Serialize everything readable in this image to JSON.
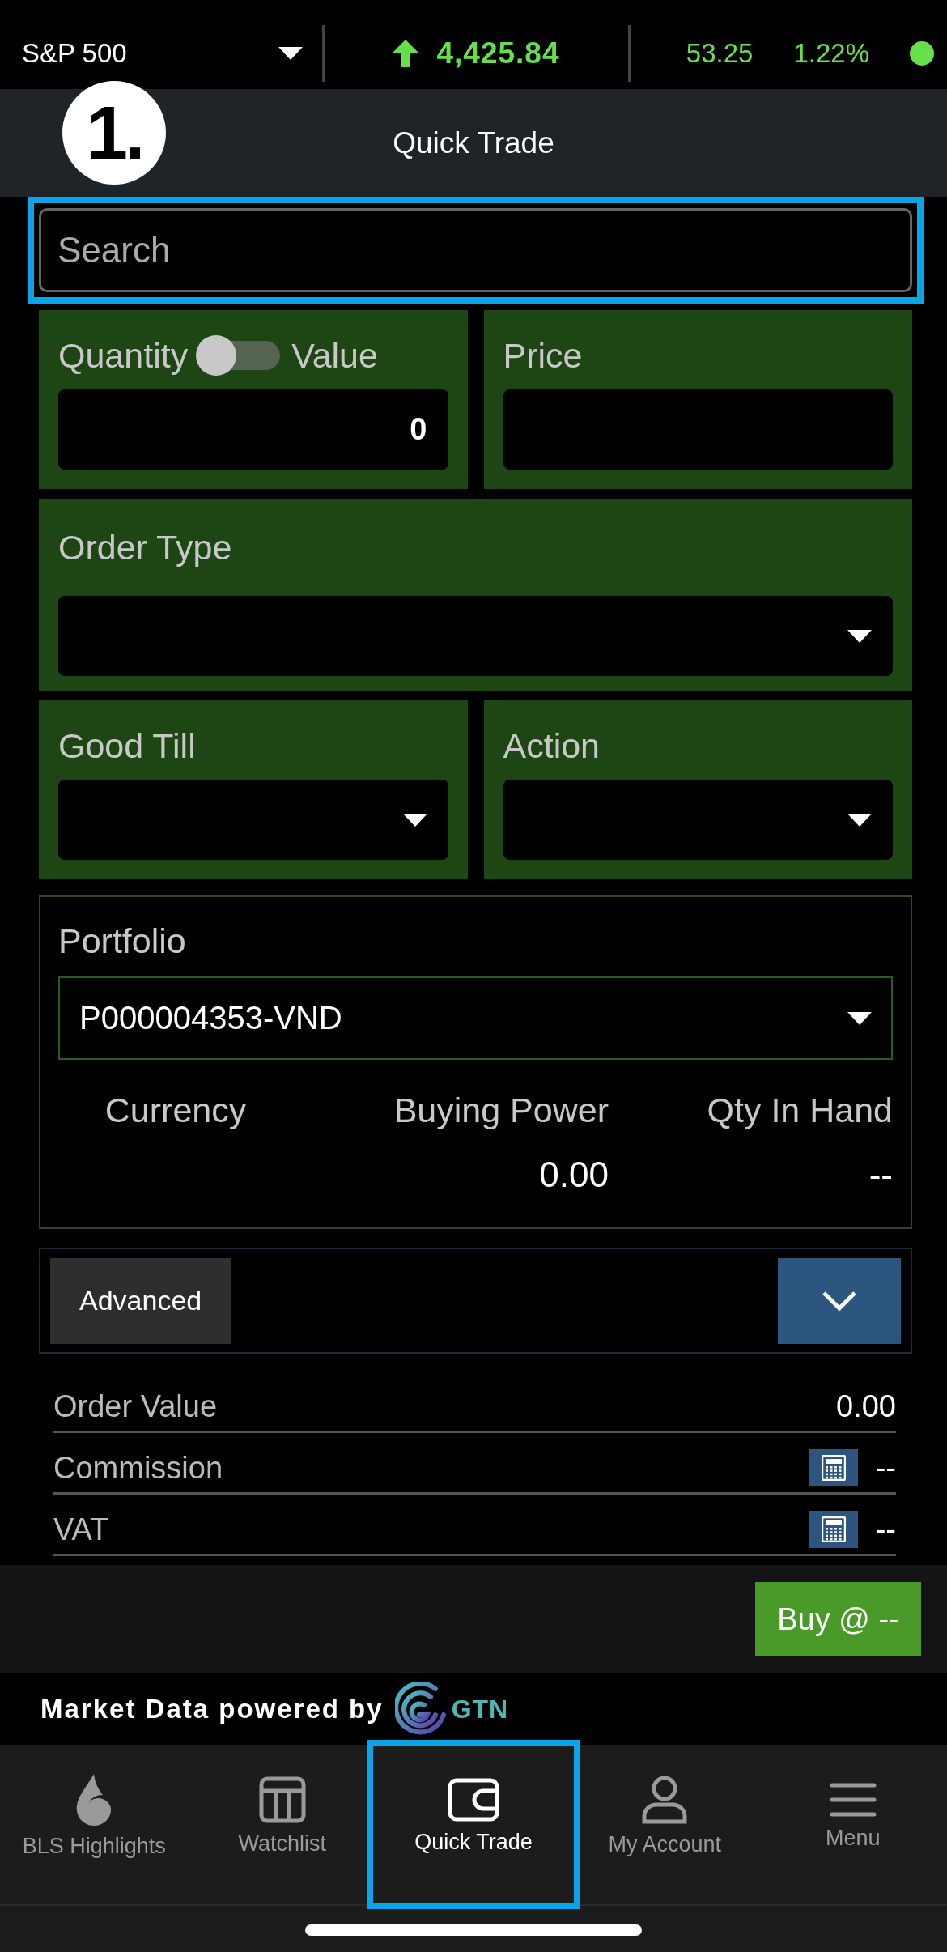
{
  "ticker": {
    "index": "S&P 500",
    "value": "4,425.84",
    "change": "53.25",
    "change_pct": "1.22%",
    "live": true
  },
  "annotation": {
    "step": "1."
  },
  "header": {
    "title": "Quick Trade"
  },
  "search": {
    "placeholder": "Search",
    "highlighted": true
  },
  "quantity": {
    "label": "Quantity",
    "alt_label": "Value",
    "toggle_on": false,
    "value": "0"
  },
  "price": {
    "label": "Price"
  },
  "order_type": {
    "label": "Order Type"
  },
  "good_till": {
    "label": "Good Till"
  },
  "action": {
    "label": "Action"
  },
  "portfolio": {
    "label": "Portfolio",
    "value": "P000004353-VND",
    "columns": [
      {
        "heading": "Currency"
      },
      {
        "heading": "Buying Power",
        "value": "0.00"
      },
      {
        "heading": "Qty In Hand",
        "value": "--"
      }
    ]
  },
  "advanced": {
    "label": "Advanced",
    "expanded": false
  },
  "summary": [
    {
      "label": "Order Value",
      "value": "0.00",
      "calculator": false
    },
    {
      "label": "Commission",
      "value": "--",
      "calculator": true
    },
    {
      "label": "VAT",
      "value": "--",
      "calculator": true
    }
  ],
  "buy_button": "Buy @ --",
  "powered_by": {
    "text": "Market Data powered by",
    "brand": "GTN"
  },
  "nav": [
    {
      "label": "BLS Highlights",
      "selected": false,
      "highlighted": false
    },
    {
      "label": "Watchlist",
      "selected": false,
      "highlighted": false
    },
    {
      "label": "Quick Trade",
      "selected": true,
      "highlighted": true
    },
    {
      "label": "My Account",
      "selected": false,
      "highlighted": false
    },
    {
      "label": "Menu",
      "selected": false,
      "highlighted": false
    }
  ]
}
